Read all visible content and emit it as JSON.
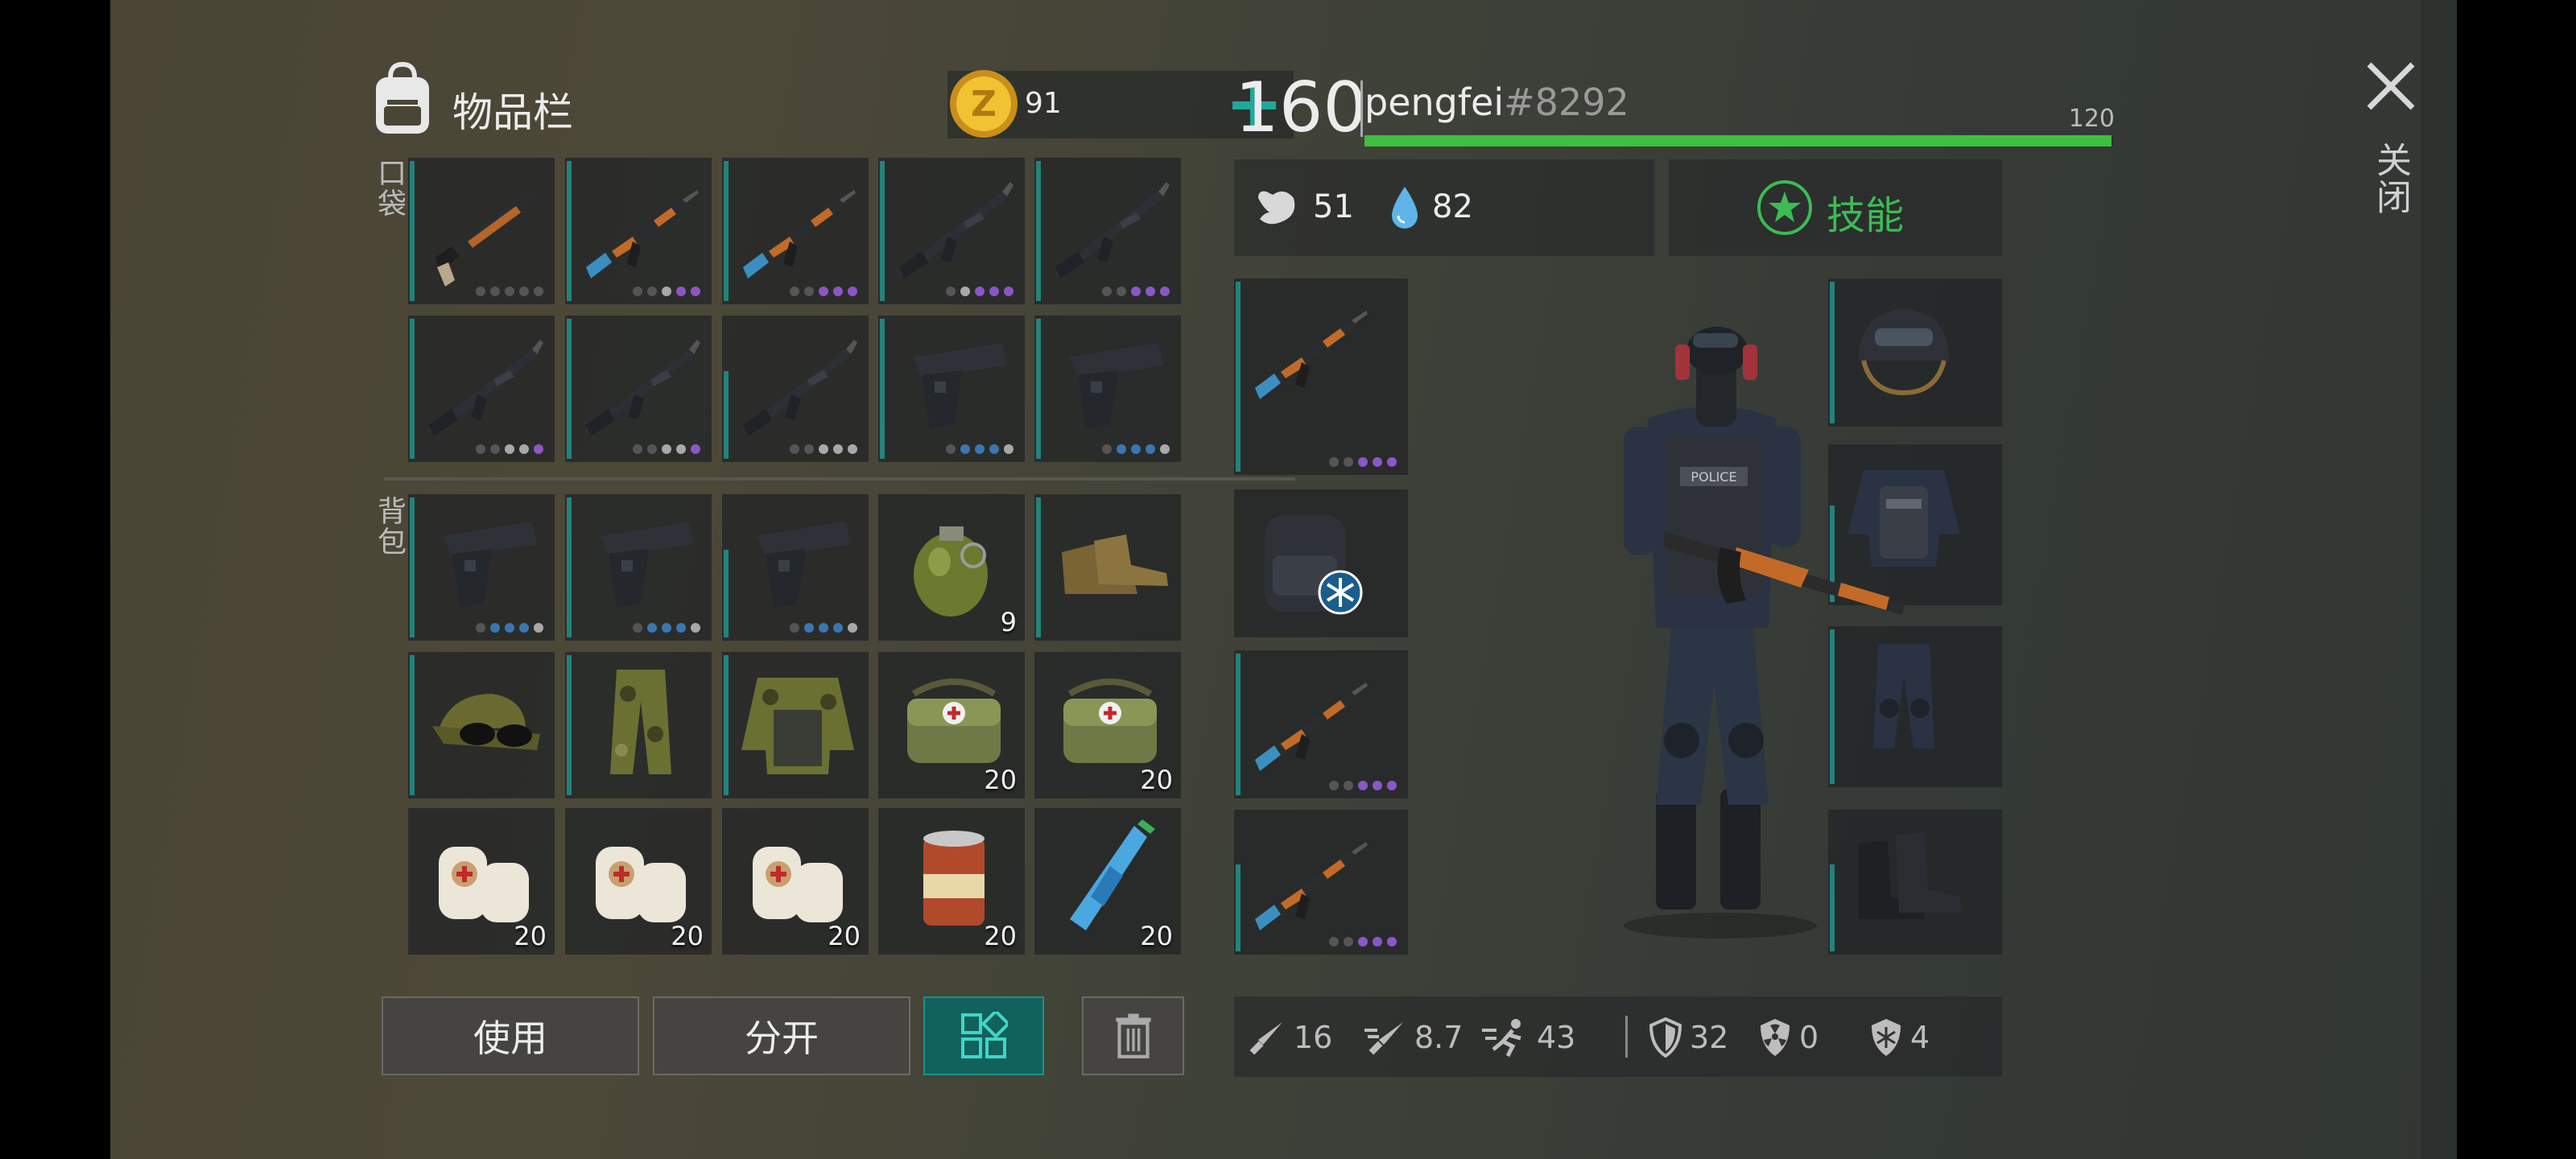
{
  "inventory": {
    "title": "物品栏",
    "currency": "91",
    "pockets_label": "口袋",
    "backpack_label": "背包",
    "pockets": [
      {
        "icon": "shotgun-icon",
        "bar": "full",
        "dots": [
          "n",
          "n",
          "n",
          "n",
          "n"
        ]
      },
      {
        "icon": "ak-rifle-icon",
        "bar": "full",
        "dots": [
          "n",
          "n",
          "w",
          "p",
          "p"
        ]
      },
      {
        "icon": "ak-rifle-icon",
        "bar": "full",
        "dots": [
          "n",
          "n",
          "p",
          "p",
          "p"
        ]
      },
      {
        "icon": "m16-rifle-icon",
        "bar": "full",
        "dots": [
          "n",
          "w",
          "p",
          "p",
          "p"
        ]
      },
      {
        "icon": "m16-rifle-icon",
        "bar": "full",
        "dots": [
          "n",
          "n",
          "p",
          "p",
          "p"
        ]
      },
      {
        "icon": "m16-rifle-icon",
        "bar": "full",
        "dots": [
          "n",
          "n",
          "w",
          "w",
          "p"
        ]
      },
      {
        "icon": "m16-rifle-icon",
        "bar": "full",
        "dots": [
          "n",
          "n",
          "w",
          "w",
          "p"
        ]
      },
      {
        "icon": "m16-rifle-icon",
        "bar": "low",
        "dots": [
          "n",
          "n",
          "w",
          "w",
          "w"
        ]
      },
      {
        "icon": "pistol-icon",
        "bar": "full",
        "dots": [
          "n",
          "b",
          "b",
          "b",
          "w"
        ]
      },
      {
        "icon": "pistol-icon",
        "bar": "full",
        "dots": [
          "n",
          "b",
          "b",
          "b",
          "w"
        ]
      }
    ],
    "backpack": [
      {
        "icon": "pistol-icon",
        "bar": "full",
        "dots": [
          "n",
          "b",
          "b",
          "b",
          "w"
        ]
      },
      {
        "icon": "pistol-icon",
        "bar": "full",
        "dots": [
          "n",
          "b",
          "b",
          "b",
          "w"
        ]
      },
      {
        "icon": "pistol-icon",
        "bar": "low",
        "dots": [
          "n",
          "b",
          "b",
          "b",
          "w"
        ]
      },
      {
        "icon": "grenade-icon",
        "bar": "none",
        "qty": "9"
      },
      {
        "icon": "boots-icon",
        "bar": "full"
      },
      {
        "icon": "cap-sunglasses-icon",
        "bar": "full"
      },
      {
        "icon": "camo-pants-icon",
        "bar": "full"
      },
      {
        "icon": "camo-vest-icon",
        "bar": "full"
      },
      {
        "icon": "medkit-bag-icon",
        "bar": "none",
        "qty": "20"
      },
      {
        "icon": "medkit-bag-icon",
        "bar": "none",
        "qty": "20"
      },
      {
        "icon": "bandage-icon",
        "bar": "none",
        "qty": "20"
      },
      {
        "icon": "bandage-icon",
        "bar": "none",
        "qty": "20"
      },
      {
        "icon": "bandage-icon",
        "bar": "none",
        "qty": "20"
      },
      {
        "icon": "canned-food-icon",
        "bar": "none",
        "qty": "20"
      },
      {
        "icon": "water-bottle-icon",
        "bar": "none",
        "qty": "20"
      }
    ],
    "buttons": {
      "use": "使用",
      "split": "分开"
    }
  },
  "player": {
    "level": "160",
    "name": "pengfei",
    "tag": "#8292",
    "xp_label": "120",
    "xp_fraction": 0.998,
    "hunger": "51",
    "thirst": "82",
    "skills_label": "技能",
    "weapon_slots": [
      {
        "icon": "ak-rifle-icon",
        "bar": "full",
        "dots": [
          "n",
          "n",
          "p",
          "p",
          "p"
        ]
      },
      {
        "icon": "backpack-frost-icon",
        "bar": "none"
      },
      {
        "icon": "ak-rifle-icon",
        "bar": "full",
        "dots": [
          "n",
          "n",
          "p",
          "p",
          "p"
        ]
      },
      {
        "icon": "ak-rifle-icon",
        "bar": "low",
        "dots": [
          "n",
          "n",
          "p",
          "p",
          "p"
        ]
      }
    ],
    "armor_slots": [
      {
        "icon": "helmet-icon",
        "bar": "full"
      },
      {
        "icon": "police-vest-icon",
        "bar": "low"
      },
      {
        "icon": "police-pants-icon",
        "bar": "full"
      },
      {
        "icon": "black-boots-icon",
        "bar": "low"
      }
    ],
    "stats": {
      "melee": "16",
      "ranged": "8.7",
      "speed": "43",
      "armor": "32",
      "radiation": "0",
      "cold": "4"
    },
    "vest_text": "POLICE"
  },
  "close_label": "关闭",
  "colors": {
    "teal": "#23837c",
    "xp_green": "#3fbf3f",
    "skill_green": "#3dbb55",
    "rarity_purple": "#8b56c8",
    "rarity_blue": "#3b76b0"
  }
}
